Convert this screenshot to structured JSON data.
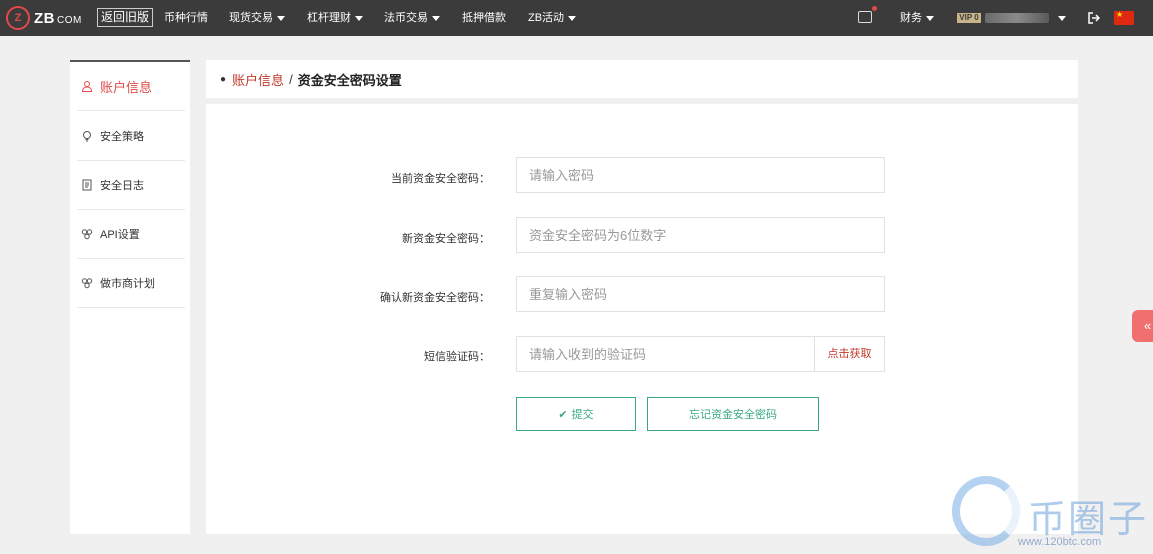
{
  "header": {
    "logo_mark": "Z",
    "logo_text": "ZB",
    "logo_com": "COM",
    "old_version": "返回旧版",
    "nav": [
      {
        "label": "币种行情",
        "dropdown": false
      },
      {
        "label": "现货交易",
        "dropdown": true
      },
      {
        "label": "杠杆理财",
        "dropdown": true
      },
      {
        "label": "法币交易",
        "dropdown": true
      },
      {
        "label": "抵押借款",
        "dropdown": false
      },
      {
        "label": "ZB活动",
        "dropdown": true
      }
    ],
    "finance": "财务",
    "vip": "VIP 0",
    "colors": {
      "bar": "#3b3b3b",
      "brand": "#e24a4a"
    }
  },
  "sidebar": {
    "items": [
      {
        "label": "账户信息",
        "icon": "user-icon",
        "active": true
      },
      {
        "label": "安全策略",
        "icon": "bulb-icon",
        "active": false
      },
      {
        "label": "安全日志",
        "icon": "document-icon",
        "active": false
      },
      {
        "label": "API设置",
        "icon": "api-icon",
        "active": false
      },
      {
        "label": "做市商计划",
        "icon": "api-icon",
        "active": false
      }
    ]
  },
  "breadcrumb": {
    "parent": "账户信息",
    "separator": "/",
    "current": "资金安全密码设置"
  },
  "form": {
    "fields": [
      {
        "label": "当前资金安全密码：",
        "placeholder": "请输入密码"
      },
      {
        "label": "新资金安全密码：",
        "placeholder": "资金安全密码为6位数字"
      },
      {
        "label": "确认新资金安全密码：",
        "placeholder": "重复输入密码"
      },
      {
        "label": "短信验证码：",
        "placeholder": "请输入收到的验证码"
      }
    ],
    "sms_button": "点击获取",
    "submit": "提交",
    "forgot": "忘记资金安全密码",
    "colors": {
      "accent": "#3aa983",
      "link": "#c0392b"
    }
  },
  "watermark": {
    "text": "币圈子",
    "url": "www.120btc.com"
  }
}
